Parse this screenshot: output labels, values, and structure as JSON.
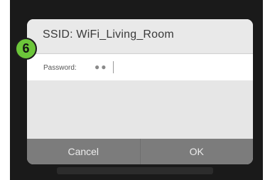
{
  "dialog": {
    "title": "SSID: WiFi_Living_Room",
    "password_label": "Password:",
    "password_value": "●●",
    "cancel_label": "Cancel",
    "ok_label": "OK"
  },
  "step_badge": "6",
  "colors": {
    "screen_background": "#1a1a1a",
    "dialog_background": "#e6e6e6",
    "button_bar": "#7c7c7c",
    "step_badge": "#6cc63a"
  }
}
